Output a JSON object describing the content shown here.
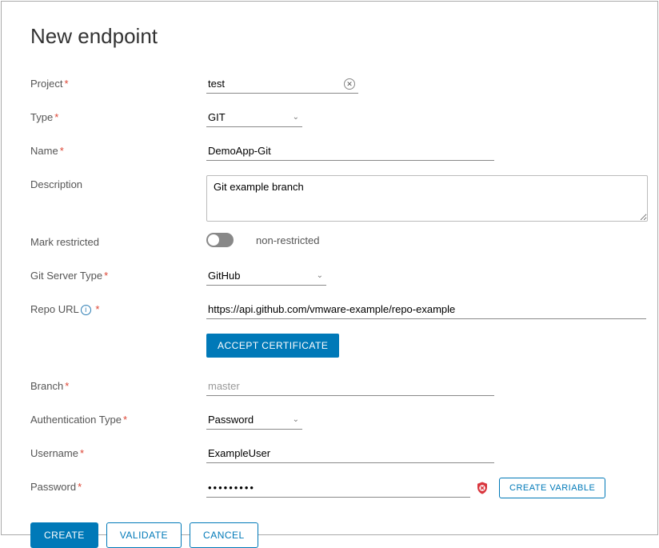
{
  "title": "New endpoint",
  "labels": {
    "project": "Project",
    "type": "Type",
    "name": "Name",
    "description": "Description",
    "mark_restricted": "Mark restricted",
    "git_server_type": "Git Server Type",
    "repo_url": "Repo URL",
    "branch": "Branch",
    "auth_type": "Authentication Type",
    "username": "Username",
    "password": "Password"
  },
  "fields": {
    "project_value": "test",
    "type_value": "GIT",
    "name_value": "DemoApp-Git",
    "description_value": "Git example branch",
    "restricted_status": "non-restricted",
    "git_server_value": "GitHub",
    "repo_url_value": "https://api.github.com/vmware-example/repo-example",
    "branch_placeholder": "master",
    "auth_type_value": "Password",
    "username_value": "ExampleUser",
    "password_value": "•••••••••"
  },
  "buttons": {
    "accept_cert": "ACCEPT CERTIFICATE",
    "create_variable": "CREATE VARIABLE",
    "create": "CREATE",
    "validate": "VALIDATE",
    "cancel": "CANCEL"
  }
}
